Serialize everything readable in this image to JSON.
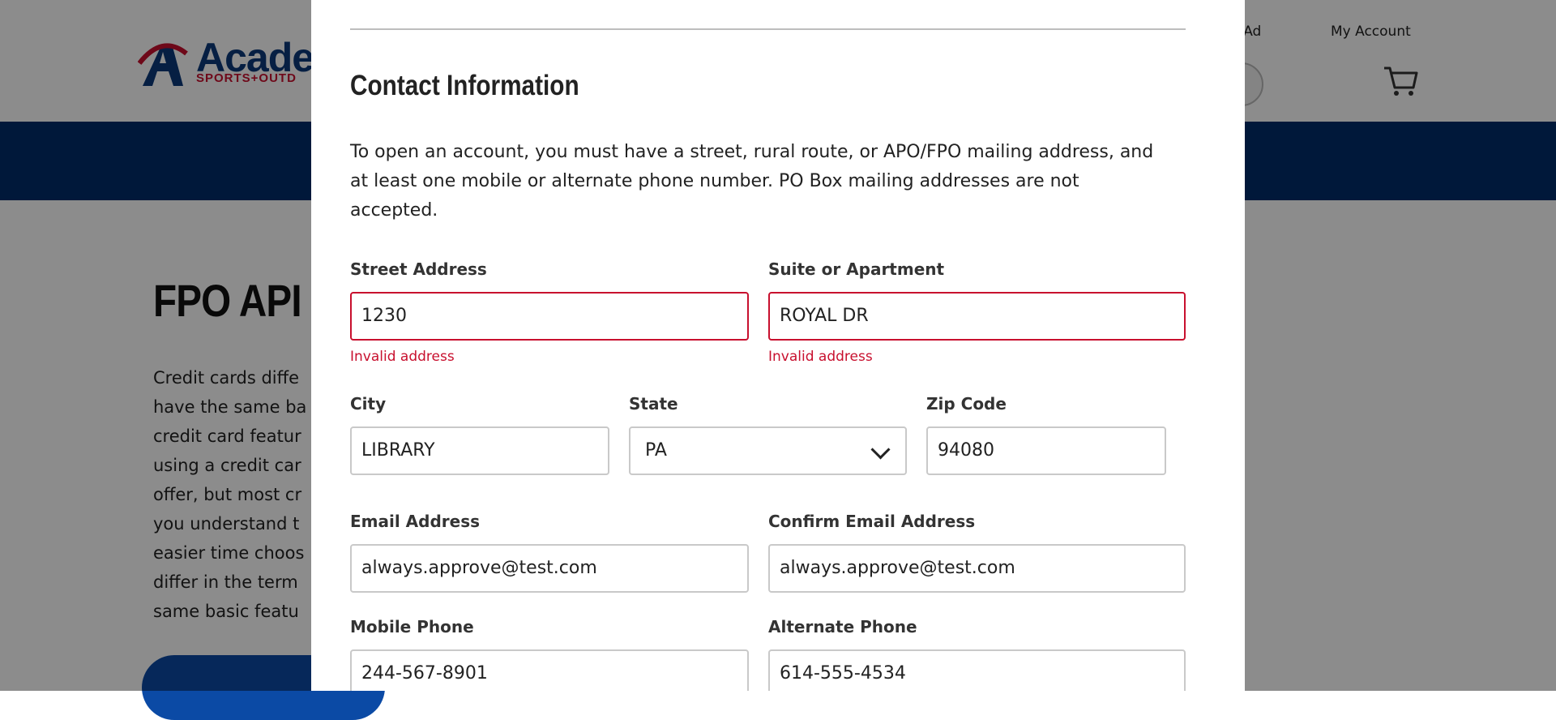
{
  "background": {
    "logo": {
      "word": "Acade",
      "tagline": "SPORTS+OUTD"
    },
    "header_links": {
      "weekly_ad": "ly Ad",
      "my_account": "My Account"
    },
    "hero_title": "FPO API",
    "hero_lines": [
      "Credit cards diffe",
      "have the same ba",
      "credit card featur",
      "using a credit car",
      "offer, but most cr",
      "you understand t",
      "easier time choos",
      "differ in the term",
      "same basic featu"
    ],
    "colors": {
      "nav": "#012d6b",
      "brand_blue": "#0b3a7a",
      "brand_red": "#c8102e"
    }
  },
  "modal": {
    "section_title": "Contact Information",
    "intro_lines": [
      "To open an account, you must have a street, rural route, or APO/FPO mailing address, and",
      "at least one mobile or alternate phone number. PO Box mailing addresses are not",
      "accepted."
    ],
    "street": {
      "label": "Street Address",
      "value": "1230",
      "error": "Invalid address"
    },
    "suite": {
      "label": "Suite or Apartment",
      "value": "ROYAL DR",
      "error": "Invalid address"
    },
    "city": {
      "label": "City",
      "value": "LIBRARY"
    },
    "state": {
      "label": "State",
      "value": "PA"
    },
    "zip": {
      "label": "Zip Code",
      "value": "94080"
    },
    "email": {
      "label": "Email Address",
      "value": "always.approve@test.com"
    },
    "confirm_email": {
      "label": "Confirm Email Address",
      "value": "always.approve@test.com"
    },
    "mobile": {
      "label": "Mobile Phone",
      "value": "244-567-8901"
    },
    "alternate": {
      "label": "Alternate Phone",
      "value": "614-555-4534"
    },
    "colors": {
      "error": "#c8102e",
      "border": "#c9c9c9"
    }
  }
}
